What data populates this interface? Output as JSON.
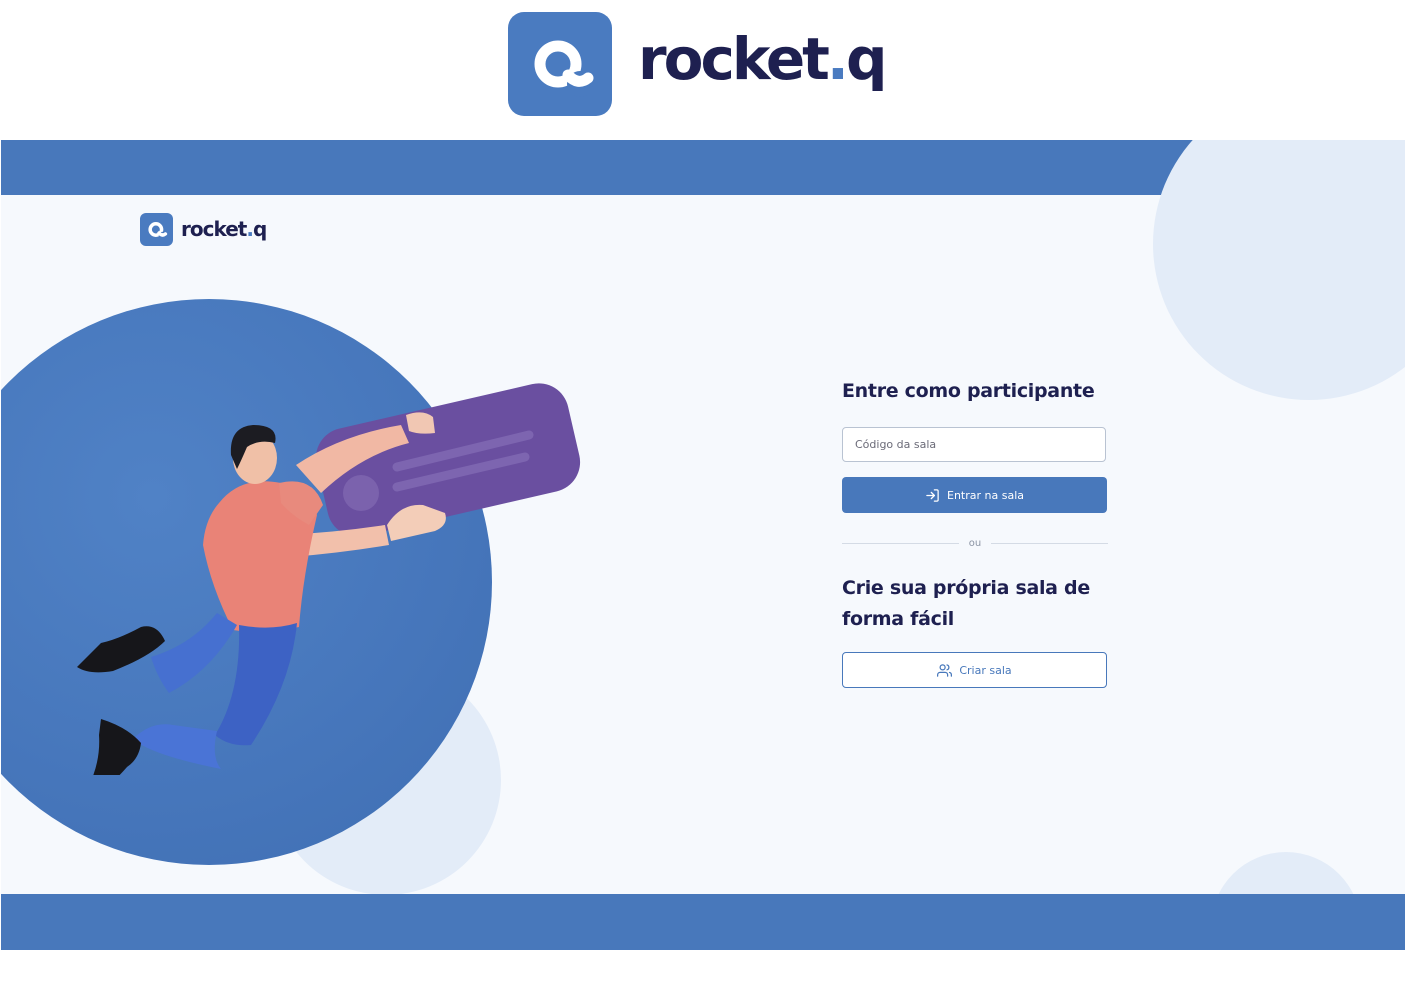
{
  "brand": {
    "name_main": "rocket",
    "name_dot": ".",
    "name_end": "q",
    "primary_color": "#4878bb",
    "dark_color": "#1e2050",
    "logo_icon": "rocketq-logo-icon"
  },
  "join": {
    "title": "Entre como participante",
    "room_code_placeholder": "Código da sala",
    "room_code_value": "",
    "enter_label": "Entrar na sala",
    "enter_icon": "log-in-icon"
  },
  "divider_label": "ou",
  "create": {
    "title": "Crie sua própria sala de forma fácil",
    "create_label": "Criar sala",
    "create_icon": "users-icon"
  },
  "illustration": {
    "name": "person-holding-chat-bubble",
    "bubble_color": "#6a4fa0"
  }
}
